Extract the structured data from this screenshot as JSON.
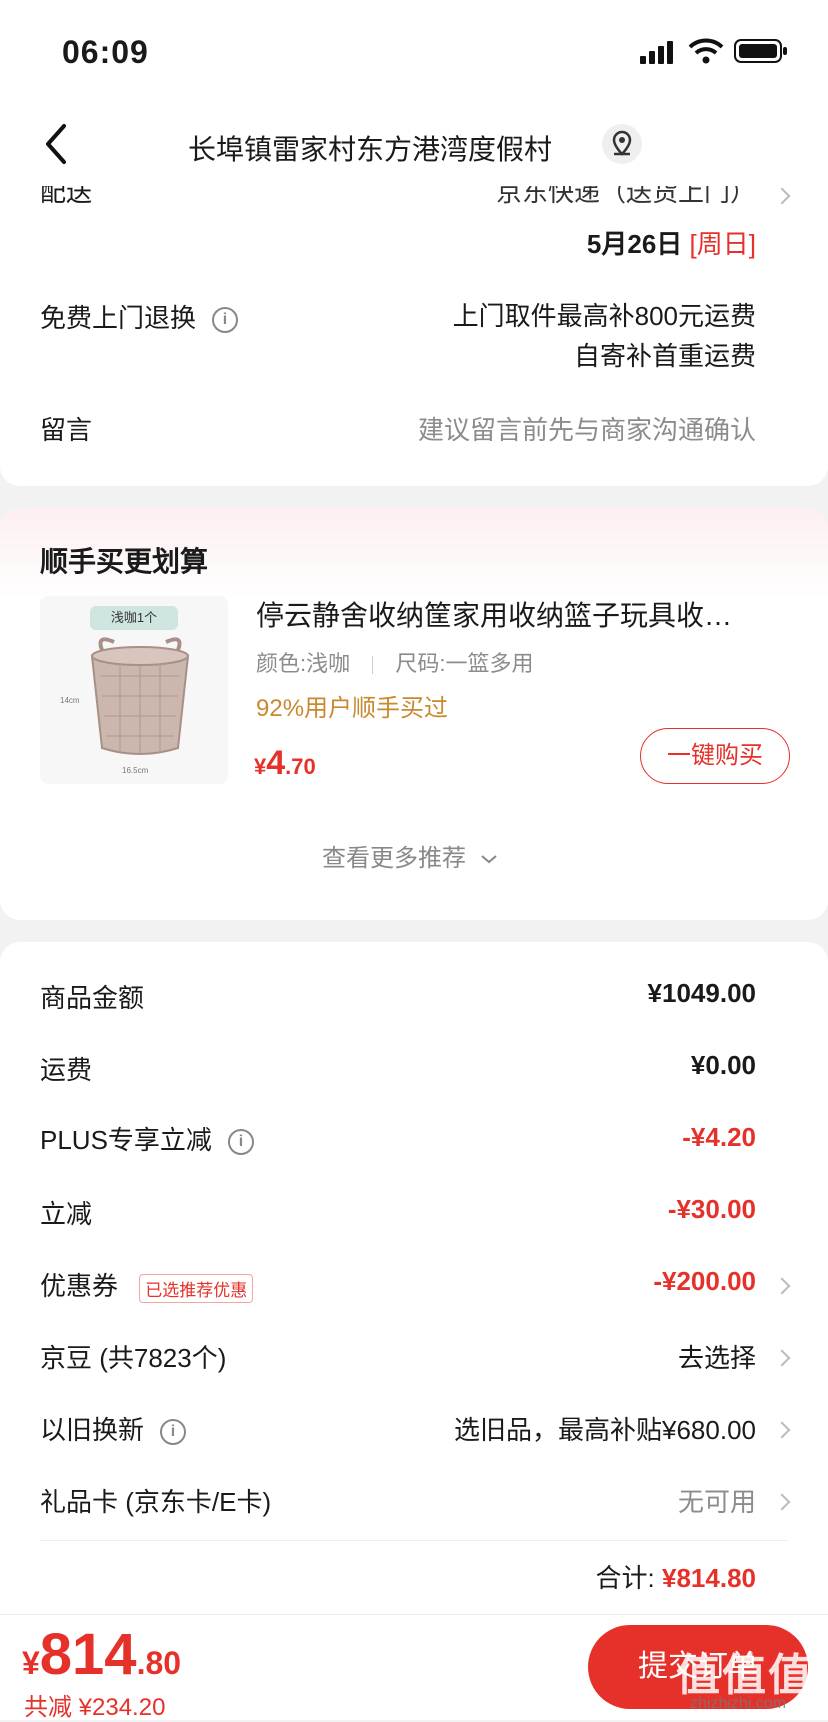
{
  "status_bar": {
    "time": "06:09"
  },
  "nav": {
    "address": "长埠镇雷家村东方港湾度假村"
  },
  "delivery": {
    "label_cut": "配送",
    "method_cut": "京东快递（送货上门）",
    "date": "5月26日",
    "weekday": "[周日]",
    "free_return_label": "免费上门退换",
    "free_return_line1": "上门取件最高补800元运费",
    "free_return_line2": "自寄补首重运费",
    "message_label": "留言",
    "message_placeholder": "建议留言前先与商家沟通确认"
  },
  "upsell": {
    "title": "顺手买更划算",
    "product_tag": "浅咖1个",
    "product_title": "停云静舍收纳筐家用收纳篮子玩具收…",
    "color": "颜色:浅咖",
    "size": "尺码:一篮多用",
    "bought": "92%用户顺手买过",
    "price_symbol": "¥",
    "price_int": "4",
    "price_dec": ".70",
    "buy_button": "一键购买",
    "more": "查看更多推荐",
    "dim_height": "14cm",
    "dim_width": "16.5cm"
  },
  "summary": {
    "goods_label": "商品金额",
    "goods_value": "¥1049.00",
    "shipping_label": "运费",
    "shipping_value": "¥0.00",
    "plus_label": "PLUS专享立减",
    "plus_value": "-¥4.20",
    "instant_label": "立减",
    "instant_value": "-¥30.00",
    "coupon_label": "优惠券",
    "coupon_badge": "已选推荐优惠",
    "coupon_value": "-¥200.00",
    "bean_label": "京豆 (共7823个)",
    "bean_value": "去选择",
    "tradein_label": "以旧换新",
    "tradein_value": "选旧品，最高补贴¥680.00",
    "giftcard_label": "礼品卡 (京东卡/E卡)",
    "giftcard_value": "无可用",
    "total_label": "合计:",
    "total_value": "¥814.80"
  },
  "bottom": {
    "symbol": "¥",
    "amount_int": "814",
    "amount_dec": ".80",
    "saved": "共减 ¥234.20",
    "submit": "提交订单",
    "watermark": "值值值",
    "watermark_url": "zhizhizhi.com"
  },
  "colors": {
    "accent": "#e5312a",
    "orange": "#c98a2e",
    "background": "#f2f2f2"
  }
}
